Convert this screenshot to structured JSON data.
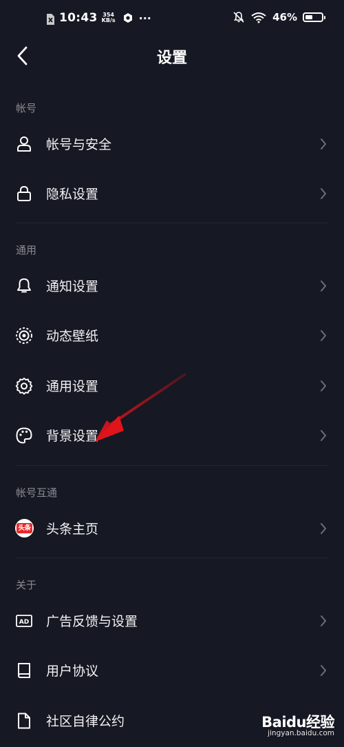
{
  "status_bar": {
    "time": "10:43",
    "net_speed_value": "354",
    "net_speed_unit": "KB/s",
    "more": "···",
    "battery_text": "46%",
    "battery_level": 0.46
  },
  "header": {
    "title": "设置"
  },
  "sections": {
    "account": {
      "label": "帐号",
      "items": [
        "帐号与安全",
        "隐私设置"
      ]
    },
    "general": {
      "label": "通用",
      "items": [
        "通知设置",
        "动态壁纸",
        "通用设置",
        "背景设置"
      ]
    },
    "interop": {
      "label": "帐号互通",
      "items": [
        "头条主页"
      ],
      "toutiao_badge": "头条"
    },
    "about": {
      "label": "关于",
      "items": [
        "广告反馈与设置",
        "用户协议",
        "社区自律公约"
      ]
    }
  },
  "icons": {
    "account_security": "user-icon",
    "privacy": "lock-icon",
    "notification": "bell-icon",
    "wallpaper": "live-wallpaper-icon",
    "general": "gear-icon",
    "background": "palette-icon",
    "toutiao": "toutiao-logo",
    "ad": "ad-icon",
    "agreement": "book-icon",
    "convention": "document-icon"
  },
  "colors": {
    "background": "#161823",
    "text": "#f2f2f4",
    "section_label": "#8a8b92",
    "divider": "#25272f",
    "annotation_arrow": "#e0141b",
    "toutiao_red": "#e8282b"
  },
  "watermark": {
    "brand": "Baidu经验",
    "url": "jingyan.baidu.com"
  }
}
